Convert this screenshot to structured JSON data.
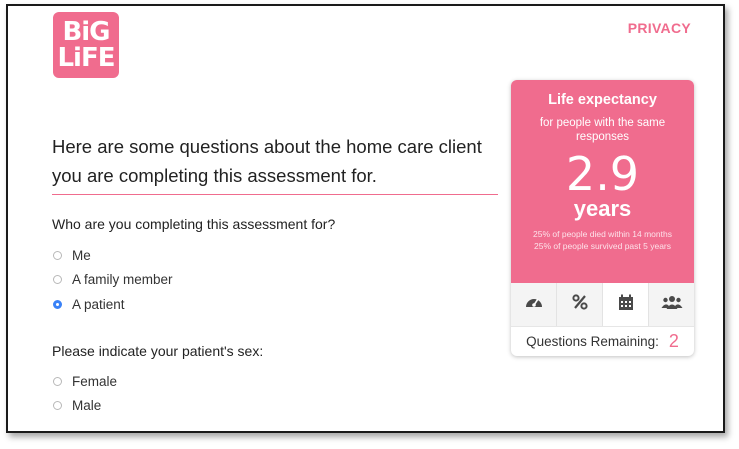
{
  "header": {
    "logo_line1": "BiG",
    "logo_line2": "LiFE",
    "privacy_label": "PRIVACY"
  },
  "main": {
    "intro": "Here are some questions about the home care client you are completing this assessment for.",
    "question1": {
      "label": "Who are you completing this assessment for?",
      "options": [
        "Me",
        "A family member",
        "A patient"
      ],
      "selected": "A patient"
    },
    "question2": {
      "label": "Please indicate your patient's sex:",
      "options": [
        "Female",
        "Male"
      ],
      "selected": null
    }
  },
  "card": {
    "title": "Life expectancy",
    "subtitle": "for people with the same responses",
    "value": "2.9",
    "unit": "years",
    "stat1": "25% of people died within 14 months",
    "stat2": "25% of people survived past 5 years",
    "tabs": [
      {
        "icon": "gauge-icon"
      },
      {
        "icon": "percent-icon"
      },
      {
        "icon": "calendar-icon",
        "active": true
      },
      {
        "icon": "people-icon"
      }
    ],
    "remaining_label": "Questions Remaining:",
    "remaining_count": "2"
  },
  "colors": {
    "brand": "#f06c8e",
    "radio_selected": "#3a82f7"
  }
}
